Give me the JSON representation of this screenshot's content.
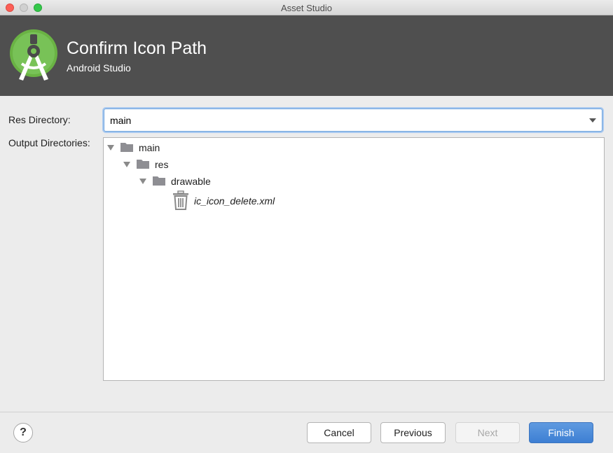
{
  "window": {
    "title": "Asset Studio",
    "controls": [
      "close",
      "minimize",
      "maximize"
    ]
  },
  "banner": {
    "title": "Confirm Icon Path",
    "subtitle": "Android Studio",
    "logo_icon": "android-studio-logo-icon",
    "background": "#4f4f4f"
  },
  "form": {
    "res_directory_label": "Res Directory:",
    "res_directory_value": "main",
    "output_directories_label": "Output Directories:"
  },
  "tree": [
    {
      "name": "main",
      "icon": "folder-icon",
      "expanded": true
    },
    {
      "name": "res",
      "icon": "folder-icon",
      "expanded": true
    },
    {
      "name": "drawable",
      "icon": "folder-icon",
      "expanded": true
    },
    {
      "name": "ic_icon_delete.xml",
      "icon": "trash-icon"
    }
  ],
  "footer": {
    "help_label": "?",
    "cancel_label": "Cancel",
    "previous_label": "Previous",
    "next_label": "Next",
    "finish_label": "Finish",
    "accent": "#3d7fd3"
  }
}
